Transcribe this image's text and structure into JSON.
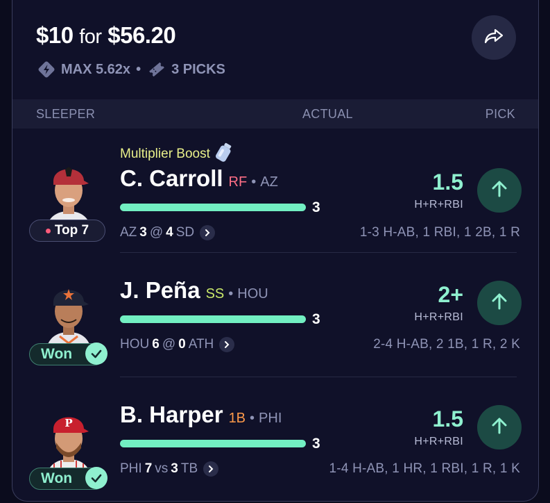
{
  "header": {
    "stake": "$10",
    "for_word": "for",
    "payout": "$56.20",
    "max_label": "MAX 5.62x",
    "separator": "•",
    "picks_label": "3 PICKS"
  },
  "columns": {
    "left": "SLEEPER",
    "middle": "ACTUAL",
    "right": "PICK"
  },
  "picks": [
    {
      "boost_label": "Multiplier Boost",
      "name": "C. Carroll",
      "position": "RF",
      "position_color": "#ff6f86",
      "team_sep": "•",
      "team": "AZ",
      "actual": "3",
      "progress_fraction": 1.0,
      "game_team1": "AZ",
      "game_score1": "3",
      "game_sep": "@",
      "game_score2": "4",
      "game_team2": "SD",
      "line": "1.5",
      "stat": "H+R+RBI",
      "result": "1-3 H-AB, 1 RBI, 1 2B, 1 R",
      "badge": "Top 7",
      "badge_type": "rank",
      "cap_color": "#b4303a"
    },
    {
      "boost_label": "",
      "name": "J. Peña",
      "position": "SS",
      "position_color": "#c9e86a",
      "team_sep": "•",
      "team": "HOU",
      "actual": "3",
      "progress_fraction": 1.0,
      "game_team1": "HOU",
      "game_score1": "6",
      "game_sep": "@",
      "game_score2": "0",
      "game_team2": "ATH",
      "line": "2+",
      "stat": "H+R+RBI",
      "result": "2-4 H-AB, 2 1B, 1 R, 2 K",
      "badge": "Won",
      "badge_type": "won",
      "cap_color": "#1f2438"
    },
    {
      "boost_label": "",
      "name": "B. Harper",
      "position": "1B",
      "position_color": "#ff9a4a",
      "team_sep": "•",
      "team": "PHI",
      "actual": "3",
      "progress_fraction": 1.0,
      "game_team1": "PHI",
      "game_score1": "7",
      "game_sep": "vs",
      "game_score2": "3",
      "game_team2": "TB",
      "line": "1.5",
      "stat": "H+R+RBI",
      "result": "1-4 H-AB, 1 HR, 1 RBI, 1 R, 1 K",
      "badge": "Won",
      "badge_type": "won",
      "cap_color": "#c8202e"
    }
  ],
  "icons": {
    "share": "share-arrow-icon",
    "max": "lightning-diamond-icon",
    "picks": "ticket-icon",
    "boost": "bottle-icon",
    "pick_direction": "arrow-up-icon",
    "chevron": "chevron-right-icon",
    "check": "check-icon"
  }
}
